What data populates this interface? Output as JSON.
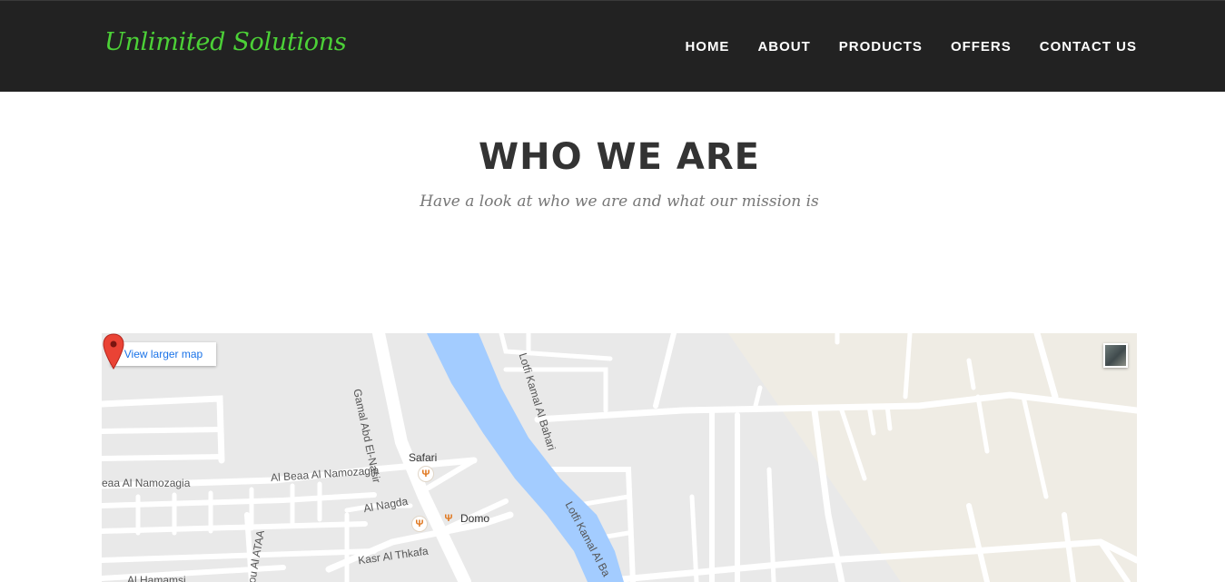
{
  "brand": "Unlimited Solutions",
  "nav": [
    "HOME",
    "ABOUT",
    "PRODUCTS",
    "OFFERS",
    "CONTACT US"
  ],
  "section": {
    "title": "WHO WE ARE",
    "subtitle": "Have a look at who we are and what our mission is"
  },
  "map": {
    "view_larger": "View larger map",
    "streets": {
      "gamal": "Gamal Abd El-Nasir",
      "lotfi_top": "Lotfi Kamal Al Bahari",
      "lotfi_bottom": "Lotfi Kamal Al Ba",
      "beaa": "Al Beaa Al Namozagia",
      "eaa": "eaa Al Namozagia",
      "nagda": "Al Nagda",
      "kasr": "Kasr Al Thkafa",
      "ataa": "ou Al ATAA",
      "hamamsi": "Al Hamamsi"
    },
    "pois": {
      "safari": "Safari",
      "domo": "Domo"
    },
    "colors": {
      "land": "#e9e9e9",
      "road": "#ffffff",
      "water": "#a3ccff",
      "park": "#efece4",
      "marker": "#ea4335"
    }
  }
}
